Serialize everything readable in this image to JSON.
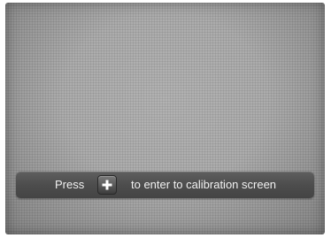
{
  "prompt": {
    "press_label": "Press",
    "key_icon": "plus-icon",
    "instruction": "to enter to calibration screen"
  }
}
